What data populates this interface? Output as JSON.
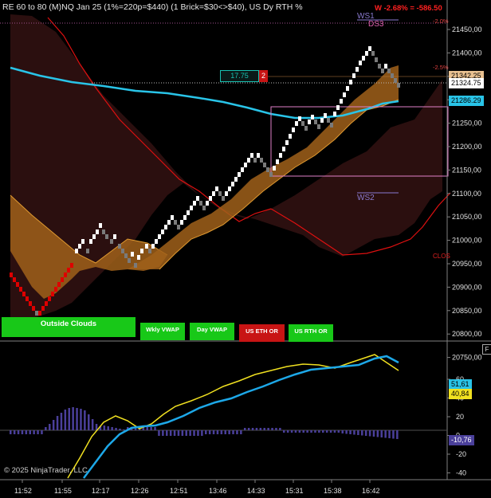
{
  "header": {
    "title": "RE 60 to 80 (M)NQ Jan 25 (1%=220p=$440) (1 Brick=$30<>$40), US Dy RTH %",
    "pnl": "W -2.68% = -586.50",
    "ws1": "WS1",
    "ds3": "DS3",
    "ws2": "WS2",
    "clos": "CLOS",
    "pct_upper": "-2.0%",
    "pct_mid": "-2.5%"
  },
  "order_flag": {
    "value": "17.75",
    "count": "2"
  },
  "price_tags": {
    "tag1": "21342.25",
    "tag2": "21324.75",
    "tag3": "21286.29"
  },
  "price_axis": [
    "21450,00",
    "21400,00",
    "21350,00",
    "21300,00",
    "21250,00",
    "21200,00",
    "21150,00",
    "21100,00",
    "21050,00",
    "21000,00",
    "20950,00",
    "20900,00",
    "20850,00",
    "20800,00",
    "20750,00"
  ],
  "buttons": {
    "outside_clouds": "Outside Clouds",
    "wkly_vwap": "Wkly VWAP",
    "day_vwap": "Day VWAP",
    "us_eth_or": "US ETH OR",
    "us_rth_or": "US RTH OR"
  },
  "indicator": {
    "axis": [
      "60",
      "40",
      "20",
      "0",
      "-20",
      "-40"
    ],
    "tag_blue": "51,61",
    "tag_yellow": "40,84",
    "tag_hist": "-10,76"
  },
  "time_axis": [
    "11:52",
    "11:55",
    "12:17",
    "12:26",
    "12:51",
    "13:46",
    "14:33",
    "15:31",
    "15:38",
    "16:42"
  ],
  "copyright": "© 2025 NinjaTrader, LLC",
  "panel_flag": "F",
  "colors": {
    "up_brick": "#ffffff",
    "down_brick": "#dd0000",
    "cloud_orange": "#a0601a",
    "cloud_dark": "#3a1414",
    "vwap_cyan": "#29c4e8",
    "stoch_yellow": "#f0e020",
    "hist_purple": "#4a3f9a"
  }
}
